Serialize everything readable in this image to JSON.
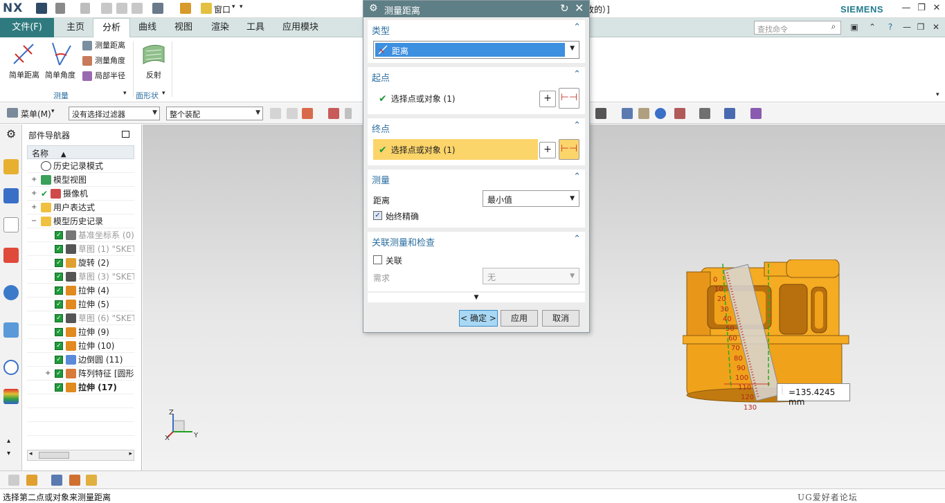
{
  "app": {
    "logo": "NX",
    "title_fragment": "改的）]",
    "brand": "SIEMENS"
  },
  "quick_access": {
    "window_menu": "窗口"
  },
  "ribbon": {
    "file_tab": "文件(F)",
    "tabs": [
      "主页",
      "分析",
      "曲线",
      "视图",
      "渲染",
      "工具",
      "应用模块"
    ],
    "active_tab": "分析",
    "search_placeholder": "查找命令",
    "buttons": {
      "simple_distance": "简单距离",
      "simple_angle": "简单角度",
      "measure_distance": "测量距离",
      "measure_angle": "测量角度",
      "local_radius": "局部半径",
      "reflection": "反射"
    },
    "groups": {
      "measure": "测量",
      "face_shape": "面形状"
    }
  },
  "toolbar2": {
    "menu": "菜单(M)",
    "filter": "没有选择过滤器",
    "scope": "整个装配"
  },
  "navigator": {
    "title": "部件导航器",
    "column": "名称",
    "items": [
      {
        "label": "历史记录模式"
      },
      {
        "label": "模型视图"
      },
      {
        "label": "摄像机"
      },
      {
        "label": "用户表达式"
      },
      {
        "label": "模型历史记录"
      },
      {
        "label": "基准坐标系 (0)"
      },
      {
        "label": "草图 (1) \"SKET"
      },
      {
        "label": "旋转 (2)"
      },
      {
        "label": "草图 (3) \"SKET"
      },
      {
        "label": "拉伸 (4)"
      },
      {
        "label": "拉伸 (5)"
      },
      {
        "label": "草图 (6) \"SKET"
      },
      {
        "label": "拉伸 (9)"
      },
      {
        "label": "拉伸 (10)"
      },
      {
        "label": "边倒圆 (11)"
      },
      {
        "label": "阵列特征 [圆形"
      },
      {
        "label": "拉伸 (17)"
      }
    ]
  },
  "dialog": {
    "title": "测量距离",
    "type_section": "类型",
    "type_value": "距离",
    "start_section": "起点",
    "start_select": "选择点或对象 (1)",
    "end_section": "终点",
    "end_select": "选择点或对象 (1)",
    "measure_section": "测量",
    "distance_label": "距离",
    "distance_value": "最小值",
    "always_precise": "始终精确",
    "assoc_section": "关联测量和检查",
    "assoc_label": "关联",
    "req_label": "需求",
    "req_value": "无",
    "ok": "< 确定 >",
    "apply": "应用",
    "cancel": "取消"
  },
  "graphics": {
    "measurement": "=135.4245 mm",
    "ruler_ticks": [
      "0",
      "10",
      "20",
      "30",
      "40",
      "50",
      "60",
      "70",
      "80",
      "90",
      "100",
      "110",
      "120",
      "130"
    ],
    "axis_x": "X",
    "axis_y": "Y",
    "axis_z": "Z"
  },
  "status": {
    "prompt": "选择第二点或对象来测量距离",
    "watermark": "UG爱好者论坛 WWW.UGSNX.COM"
  },
  "colors": {
    "part_orange": "#f0a21a",
    "dialog_title": "#5f7f86",
    "highlight_row": "#fbd46a",
    "type_select_bg": "#3d8fe0"
  }
}
